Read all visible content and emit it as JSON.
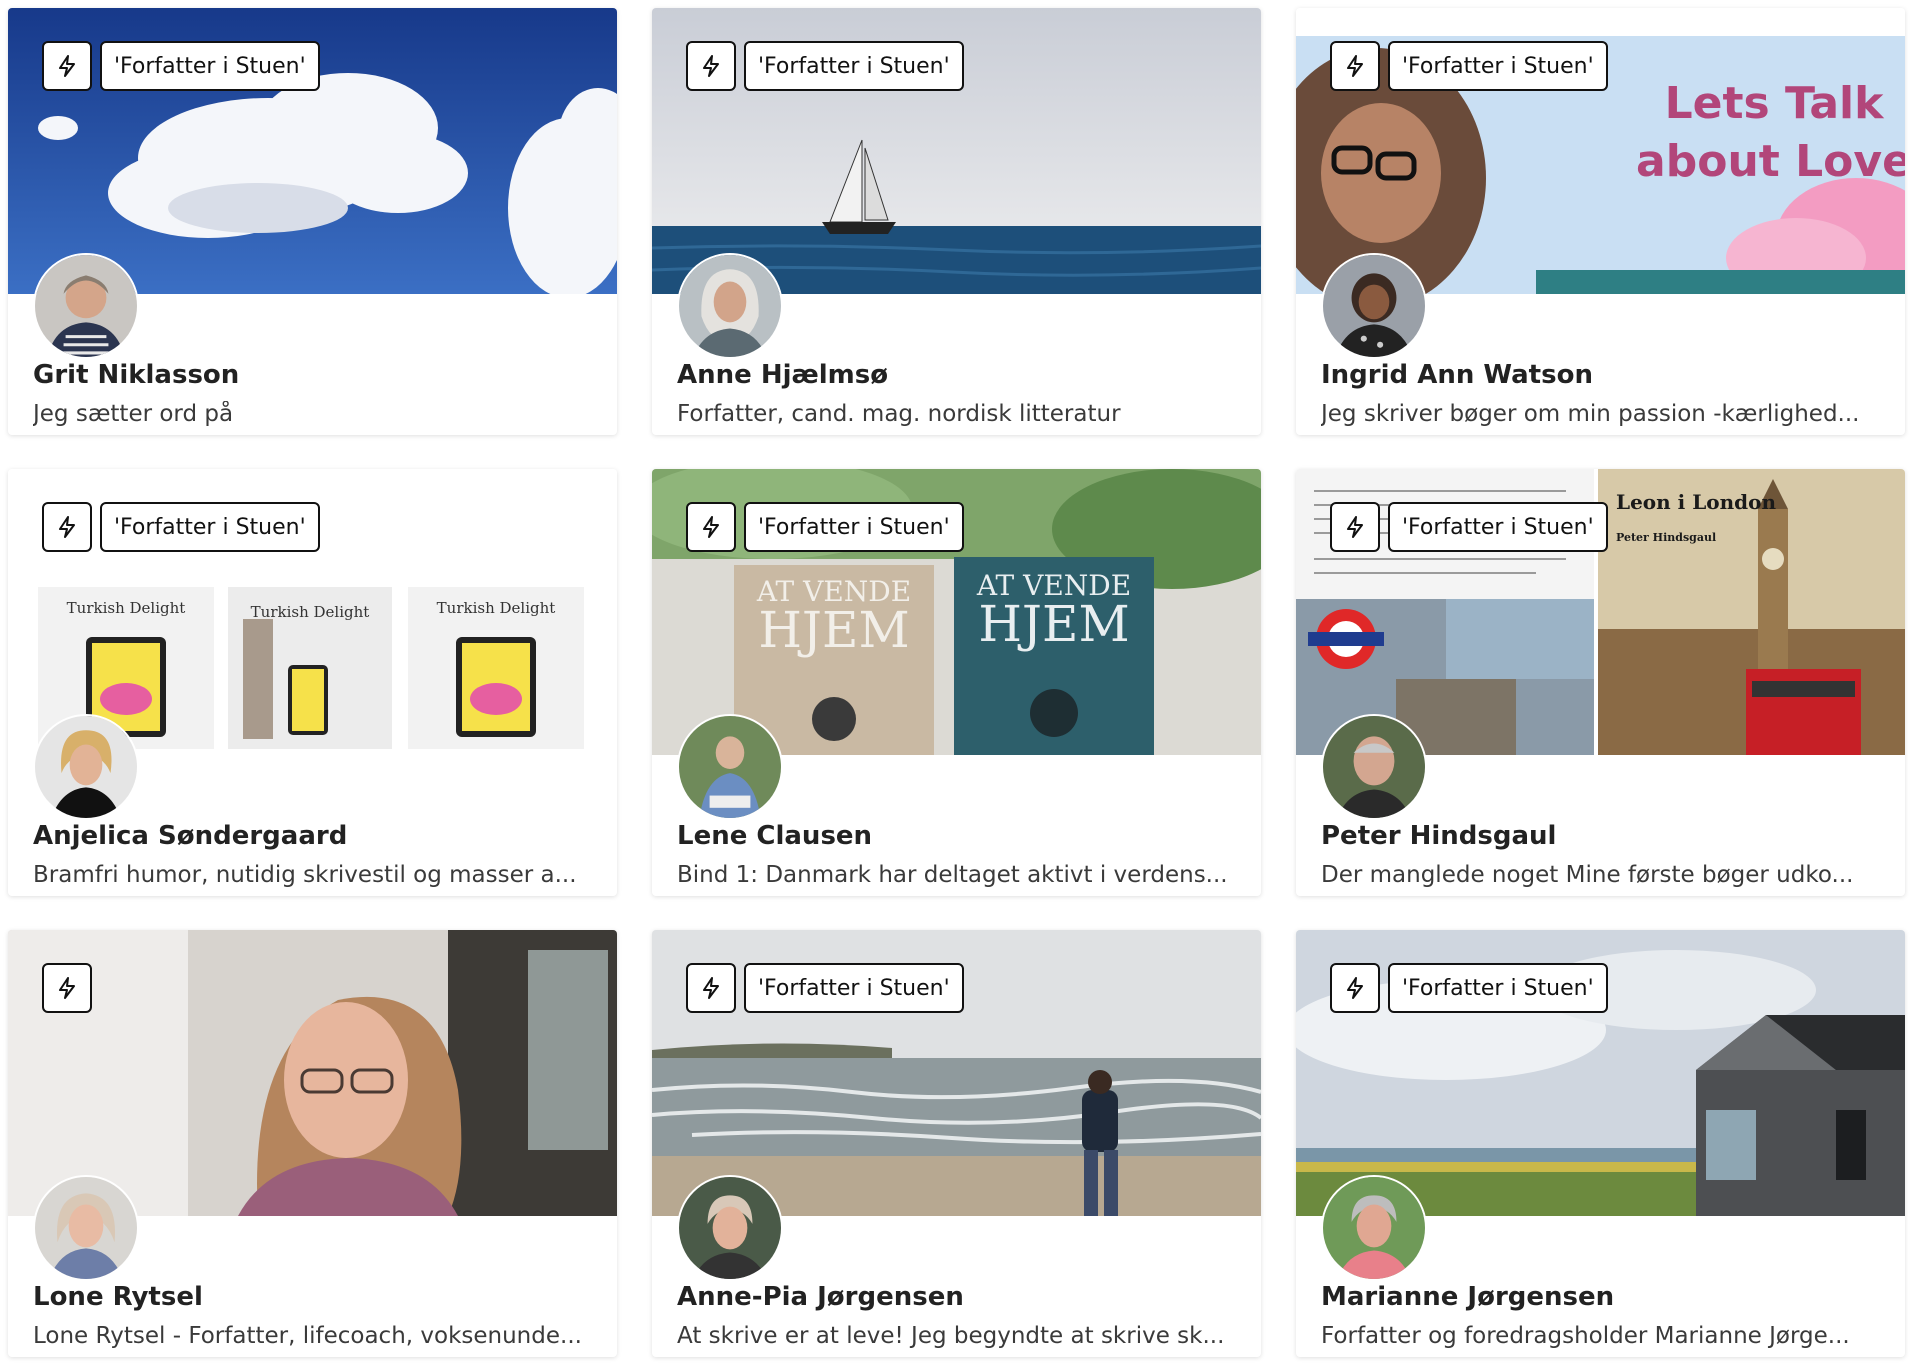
{
  "tag_label": "'Forfatter i Stuen'",
  "bolt_icon": "lightning-icon",
  "cards": [
    {
      "name": "Grit Niklasson",
      "desc": "Jeg sætter ord på",
      "has_tag": true,
      "cover": "sky-clouds"
    },
    {
      "name": "Anne Hjælmsø",
      "desc": "Forfatter, cand. mag. nordisk litteratur",
      "has_tag": true,
      "cover": "sailboat-sea"
    },
    {
      "name": "Ingrid Ann Watson",
      "desc": "Jeg skriver bøger om min passion -kærlighed...",
      "has_tag": true,
      "cover": "lets-talk-about-love",
      "cover_text": [
        "Lets Talk",
        "about Love"
      ]
    },
    {
      "name": "Anjelica Søndergaard",
      "desc": "Bramfri humor, nutidig skrivestil og masser a...",
      "has_tag": true,
      "cover": "turkish-delight-books",
      "cover_text": [
        "Turkish Delight",
        "Turkish Delight",
        "Turkish Delight"
      ]
    },
    {
      "name": "Lene Clausen",
      "desc": "Bind 1: Danmark har deltaget aktivt i verdens...",
      "has_tag": true,
      "cover": "at-vende-hjem-books",
      "cover_text": [
        "AT VENDE",
        "HJEM",
        "AT VENDE",
        "HJEM"
      ]
    },
    {
      "name": "Peter Hindsgaul",
      "desc": "Der manglede noget Mine første bøger udko...",
      "has_tag": true,
      "cover": "leon-i-london",
      "cover_text": [
        "Leon i London",
        "Peter Hindsgaul"
      ]
    },
    {
      "name": "Lone Rytsel",
      "desc": "Lone Rytsel - Forfatter, lifecoach, voksenunde...",
      "has_tag": false,
      "cover": "portrait"
    },
    {
      "name": "Anne-Pia Jørgensen",
      "desc": "At skrive er at leve! Jeg begyndte at skrive sk...",
      "has_tag": true,
      "cover": "beach-walker"
    },
    {
      "name": "Marianne Jørgensen",
      "desc": "Forfatter og foredragsholder Marianne Jørge...",
      "has_tag": true,
      "cover": "house-landscape"
    }
  ]
}
